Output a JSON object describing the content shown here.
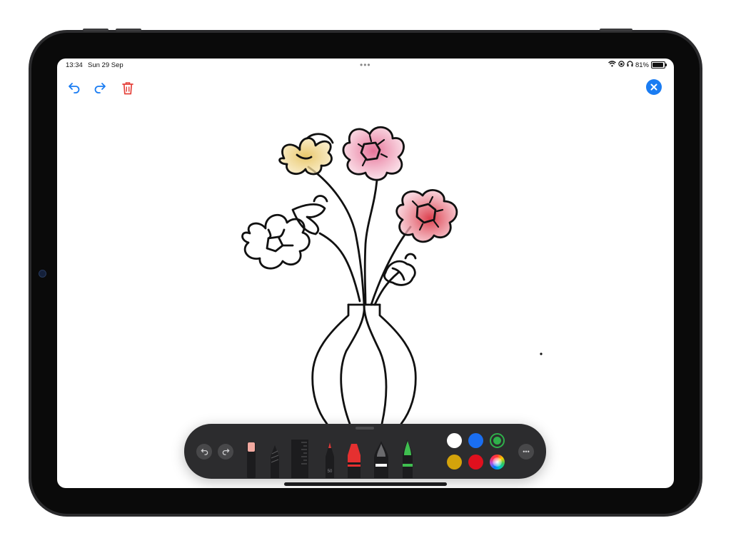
{
  "status_bar": {
    "time": "13:34",
    "date": "Sun 29 Sep",
    "battery": "81%",
    "battery_level": 0.81,
    "multitask_dots": "•••"
  },
  "icons": {
    "undo": "undo-arrow-icon",
    "redo": "redo-arrow-icon",
    "delete": "trash-icon",
    "close": "close-icon",
    "wifi": "wifi-icon",
    "orientation_lock": "orientation-lock-icon",
    "headphones": "headphones-icon"
  },
  "colors": {
    "accent": "#1a7cf2",
    "delete": "#e5413a",
    "toolbar": "#2c2c2e",
    "stroke": "#111111"
  },
  "toolbar": {
    "tools": [
      {
        "name": "eraser",
        "icon": "eraser-icon",
        "tip_color": "#f2a9a0"
      },
      {
        "name": "lasso",
        "icon": "lasso-icon"
      },
      {
        "name": "ruler",
        "icon": "ruler-icon"
      },
      {
        "name": "pencil",
        "icon": "pencil-icon",
        "tip_color": "#d93a3a",
        "label": "50"
      },
      {
        "name": "marker",
        "icon": "marker-icon",
        "tip_color": "#e53030"
      },
      {
        "name": "fountain-pen",
        "icon": "fountain-pen-icon",
        "tip_color": "#ffffff"
      },
      {
        "name": "watercolor-brush",
        "icon": "brush-icon",
        "tip_color": "#3fbf4f"
      }
    ],
    "swatches": [
      {
        "name": "white",
        "color": "#ffffff"
      },
      {
        "name": "blue",
        "color": "#1a6ef0"
      },
      {
        "name": "green",
        "color": "#2fb04a",
        "selected": true
      },
      {
        "name": "yellow",
        "color": "#d4a30b"
      },
      {
        "name": "red",
        "color": "#e0101e"
      },
      {
        "name": "color-wheel",
        "color": "multicolor"
      }
    ],
    "more": "•••"
  }
}
